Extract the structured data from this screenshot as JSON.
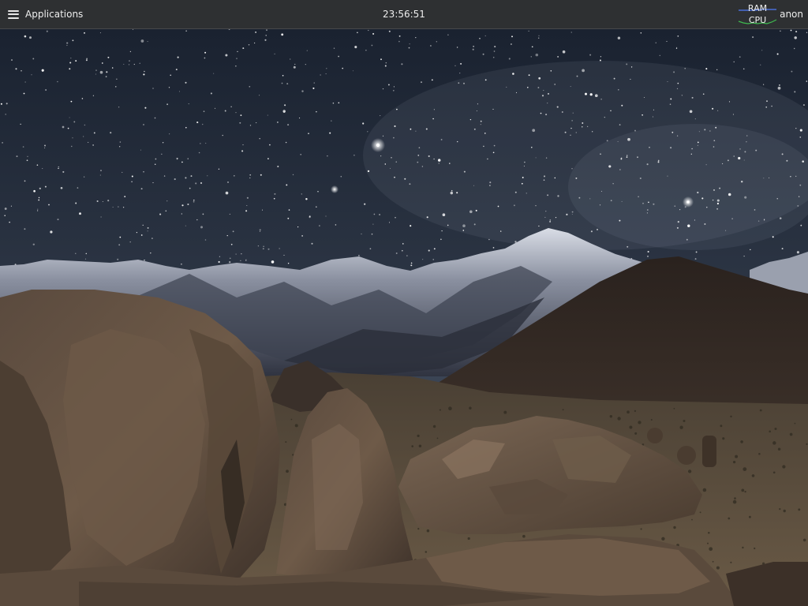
{
  "panel": {
    "applications_label": "Applications",
    "clock": "23:56:51",
    "system_monitor": {
      "ram_label": "RAM",
      "cpu_label": "CPU",
      "ram_color": "#4a6fd8",
      "cpu_color": "#3fb950"
    },
    "username": "anon"
  },
  "wallpaper": {
    "icon": "wallpaper-image"
  }
}
